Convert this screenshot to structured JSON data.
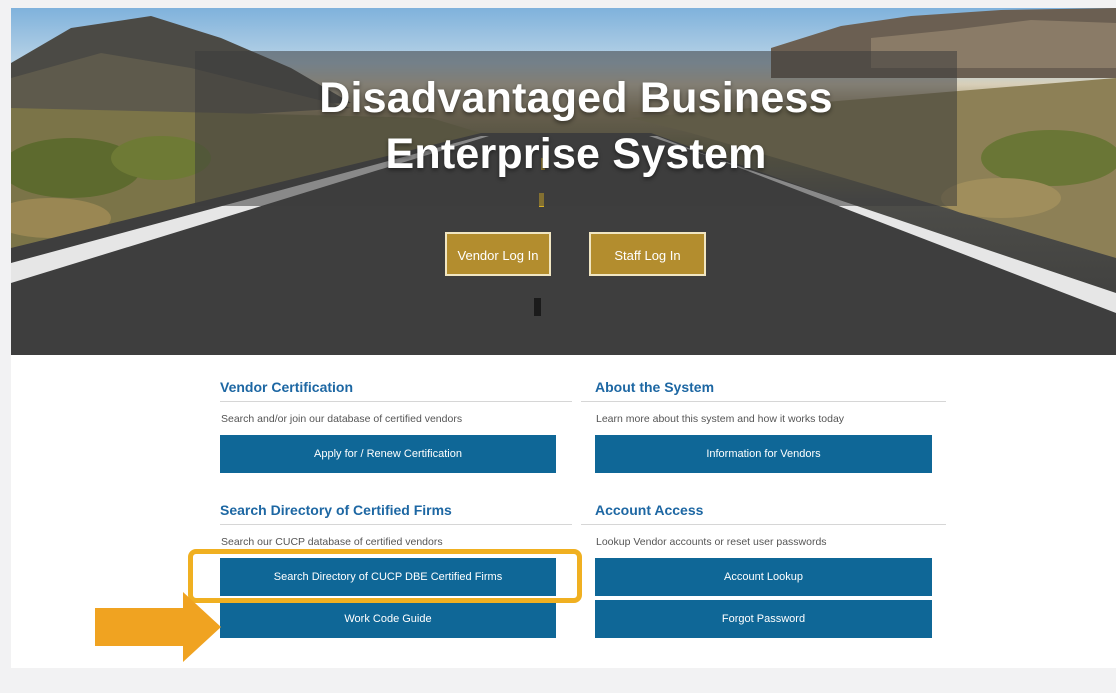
{
  "hero": {
    "title_line1": "Disadvantaged Business",
    "title_line2": "Enterprise System",
    "vendor_login": "Vendor Log In",
    "staff_login": "Staff Log In"
  },
  "vendor_certification": {
    "title": "Vendor Certification",
    "description": "Search and/or join our database of certified vendors",
    "button": "Apply for / Renew Certification"
  },
  "about_system": {
    "title": "About the System",
    "description": "Learn more about this system and how it works today",
    "button": "Information for Vendors"
  },
  "search_directory": {
    "title": "Search Directory of Certified Firms",
    "description": "Search our CUCP database of certified vendors",
    "button_search": "Search Directory of CUCP DBE Certified Firms",
    "button_work_code": "Work Code Guide"
  },
  "account_access": {
    "title": "Account Access",
    "description": "Lookup Vendor accounts or reset user passwords",
    "button_lookup": "Account Lookup",
    "button_forgot": "Forgot Password"
  },
  "colors": {
    "accent_gold": "#b38d2e",
    "button_blue": "#0f6797",
    "heading_blue": "#1d67a3",
    "highlight_orange": "#f0b021"
  }
}
